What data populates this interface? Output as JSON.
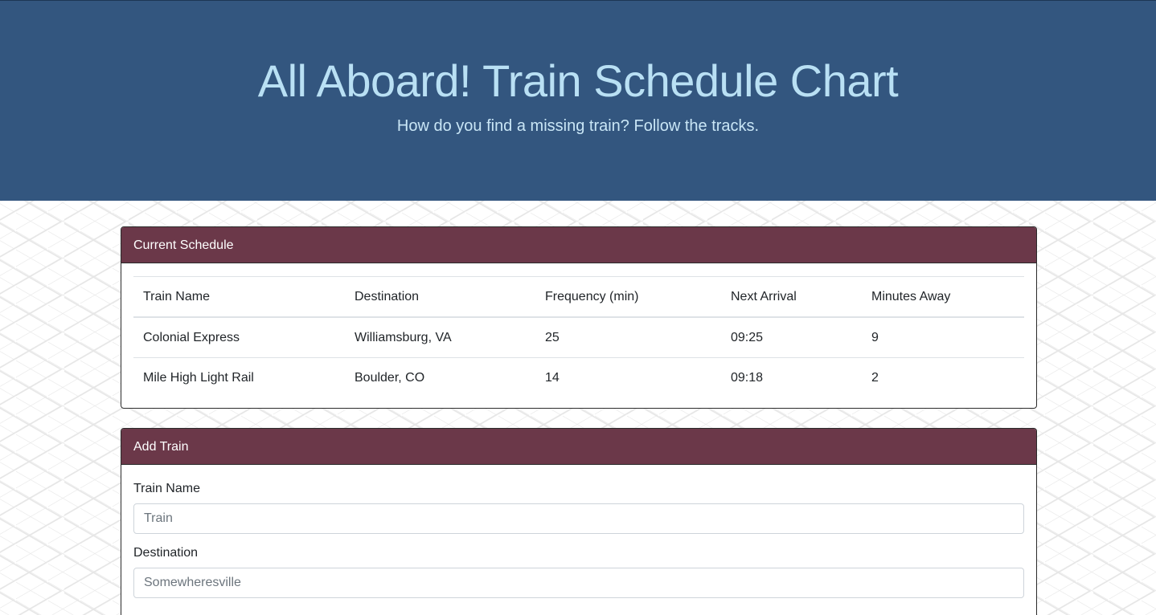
{
  "header": {
    "title": "All Aboard! Train Schedule Chart",
    "subtitle": "How do you find a missing train? Follow the tracks."
  },
  "schedule": {
    "heading": "Current Schedule",
    "columns": [
      "Train Name",
      "Destination",
      "Frequency (min)",
      "Next Arrival",
      "Minutes Away"
    ],
    "rows": [
      [
        "Colonial Express",
        "Williamsburg, VA",
        "25",
        "09:25",
        "9"
      ],
      [
        "Mile High Light Rail",
        "Boulder, CO",
        "14",
        "09:18",
        "2"
      ]
    ]
  },
  "add_train": {
    "heading": "Add Train",
    "fields": [
      {
        "label": "Train Name",
        "placeholder": "Train",
        "value": ""
      },
      {
        "label": "Destination",
        "placeholder": "Somewheresville",
        "value": ""
      }
    ]
  },
  "colors": {
    "header_bg": "#33567f",
    "title_color": "#b9e0f4",
    "card_header_bg": "#6b3849"
  }
}
